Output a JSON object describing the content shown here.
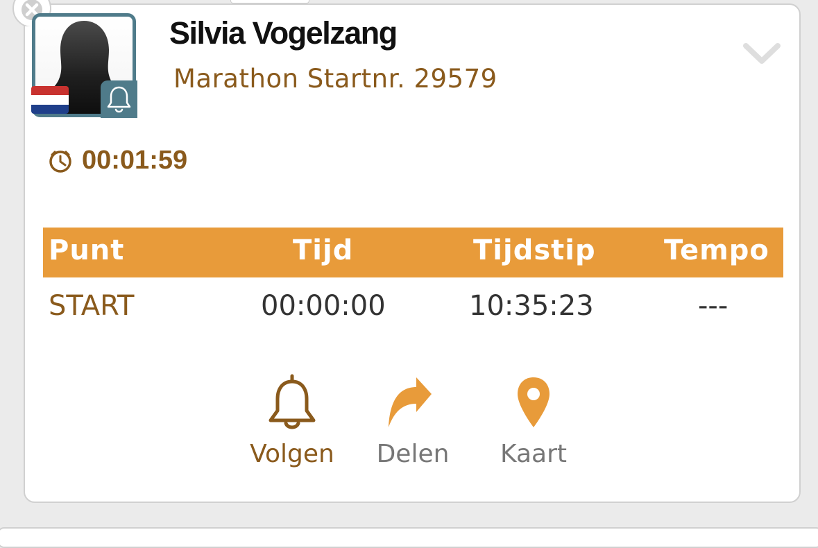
{
  "colors": {
    "accent": "#e89b3a",
    "brown": "#8a5a1c",
    "avatar_border": "#4f7b8a",
    "text_dark": "#333333",
    "muted": "#777777"
  },
  "runner": {
    "name": "Silvia Vogelzang",
    "subtitle": "Marathon Startnr. 29579",
    "flag": "netherlands-flag"
  },
  "elapsed_time": "00:01:59",
  "table": {
    "headers": [
      "Punt",
      "Tijd",
      "Tijdstip",
      "Tempo"
    ],
    "rows": [
      [
        "START",
        "00:00:00",
        "10:35:23",
        "---"
      ]
    ]
  },
  "actions": [
    {
      "label": "Volgen",
      "icon": "bell-icon"
    },
    {
      "label": "Delen",
      "icon": "share-icon"
    },
    {
      "label": "Kaart",
      "icon": "map-pin-icon"
    }
  ]
}
